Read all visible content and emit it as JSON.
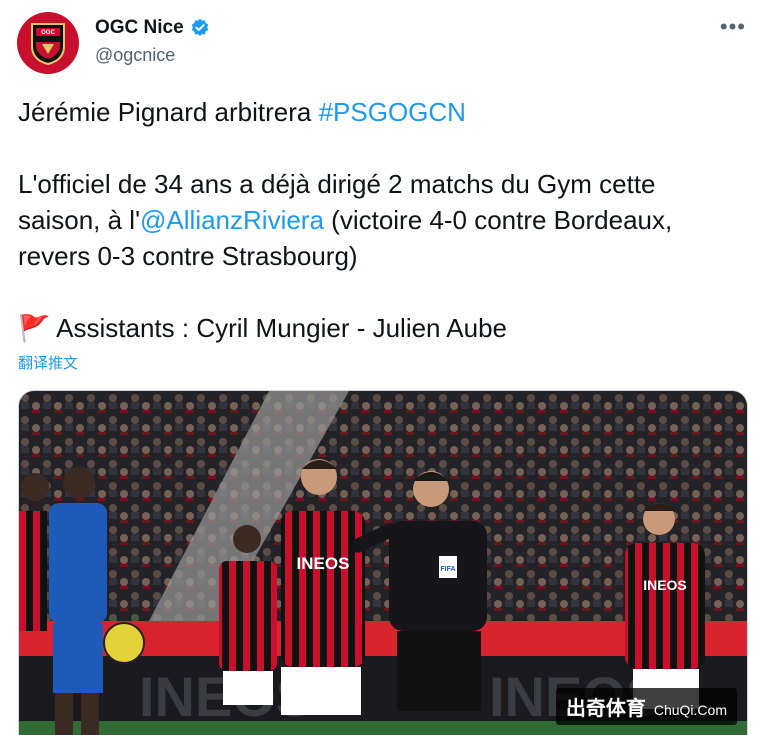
{
  "account": {
    "display_name": "OGC Nice",
    "handle": "@ogcnice",
    "verified": true,
    "avatar_text": "OGC NICE"
  },
  "more_icon": "more-horizontal-icon",
  "tweet": {
    "line1_prefix": "Jérémie Pignard arbitrera ",
    "line1_hashtag": "#PSGOGCN",
    "para2_part1": "L'officiel de 34 ans a déjà dirigé 2 matchs du Gym cette saison, à l'",
    "para2_mention": "@AllianzRiviera",
    "para2_part2": " (victoire 4-0 contre Bordeaux, revers 0-3 contre Strasbourg)",
    "flag_emoji": "🚩",
    "assistants": "Assistants : Cyril Mungier - Julien Aube"
  },
  "translate_label": "翻译推文",
  "media": {
    "shirt_sponsor": "INEOS",
    "board_text": "INEOS",
    "referee_badge": "FIFA"
  },
  "watermark": {
    "cn": "出奇体育",
    "en": "ChuQi.Com"
  },
  "colors": {
    "link": "#1d9bf0",
    "verified": "#1d9bf0",
    "nice_red": "#c8102e",
    "away_blue": "#1e5bb8"
  }
}
